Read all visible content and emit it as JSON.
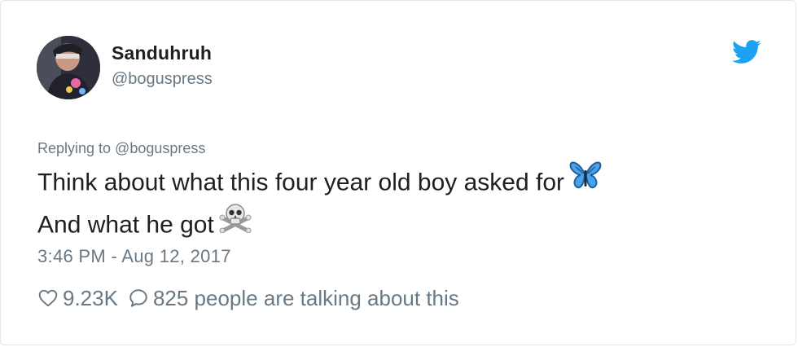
{
  "tweet": {
    "author": {
      "name": "Sanduhruh",
      "handle": "@boguspress"
    },
    "reply_to": "Replying to @boguspress",
    "lines": [
      {
        "text": "Think about what this four year old boy asked for",
        "emoji": "butterfly-emoji"
      },
      {
        "text": "And what he got",
        "emoji": "skull-crossbones-emoji"
      }
    ],
    "timestamp": "3:46 PM - Aug 12, 2017",
    "likes": "9.23K",
    "replies_text": "825 people are talking about this"
  },
  "colors": {
    "text_primary": "#1c2022",
    "text_secondary": "#697882",
    "twitter_blue": "#1da1f2",
    "border": "#e1e8ed"
  }
}
